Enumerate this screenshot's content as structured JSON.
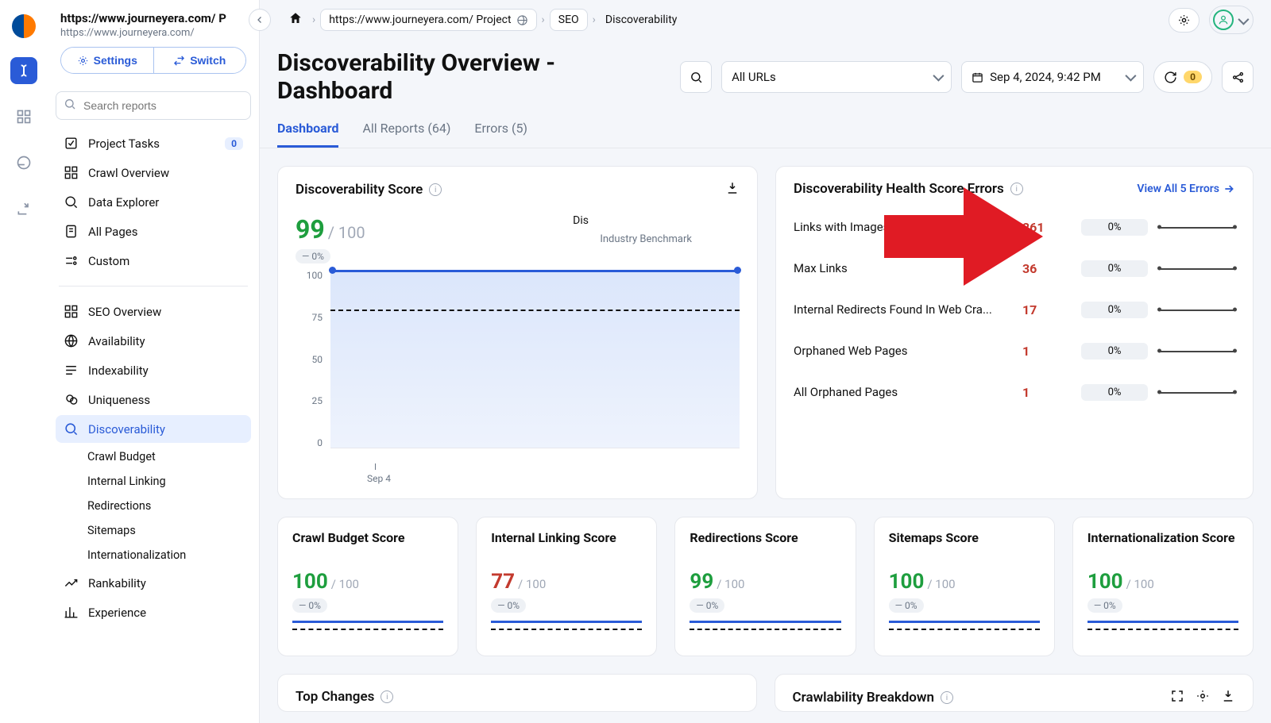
{
  "project": {
    "title": "https://www.journeyera.com/ P",
    "url": "https://www.journeyera.com/"
  },
  "sidebar_buttons": {
    "settings": "Settings",
    "switch": "Switch"
  },
  "search_placeholder": "Search reports",
  "nav": {
    "tasks": "Project Tasks",
    "tasks_badge": "0",
    "crawl_overview": "Crawl Overview",
    "data_explorer": "Data Explorer",
    "all_pages": "All Pages",
    "custom": "Custom",
    "seo_overview": "SEO Overview",
    "availability": "Availability",
    "indexability": "Indexability",
    "uniqueness": "Uniqueness",
    "discoverability": "Discoverability",
    "sub": {
      "crawl_budget": "Crawl Budget",
      "internal_linking": "Internal Linking",
      "redirections": "Redirections",
      "sitemaps": "Sitemaps",
      "intl": "Internationalization"
    },
    "rankability": "Rankability",
    "experience": "Experience"
  },
  "crumbs": {
    "project": "https://www.journeyera.com/ Project",
    "seo": "SEO",
    "leaf": "Discoverability"
  },
  "page_title": "Discoverability Overview - Dashboard",
  "filters": {
    "url": "All URLs",
    "date": "Sep 4, 2024, 9:42 PM",
    "refresh_count": "0"
  },
  "tabs": {
    "dashboard": "Dashboard",
    "all_reports": "All Reports (64)",
    "errors": "Errors (5)"
  },
  "score_card": {
    "title": "Discoverability Score",
    "value": "99",
    "denom": " / 100",
    "delta": "—  0%",
    "bench": "Industry Benchmark",
    "disco_prefix": "Dis",
    "x_label": "Sep 4"
  },
  "chart_data": {
    "type": "line",
    "x": [
      "Sep 4"
    ],
    "series": [
      {
        "name": "Score",
        "values": [
          99
        ]
      },
      {
        "name": "Benchmark",
        "values": [
          78
        ]
      }
    ],
    "ylabel": "",
    "ylim": [
      0,
      100
    ],
    "yticks": [
      100,
      75,
      50,
      25,
      0
    ]
  },
  "errors_card": {
    "title": "Discoverability Health Score Errors",
    "link": "View All 5 Errors"
  },
  "error_rows": [
    {
      "name": "Links with Images Missing Alt Tags",
      "count": "261",
      "pct": "0%"
    },
    {
      "name": "Max Links",
      "count": "36",
      "pct": "0%"
    },
    {
      "name": "Internal Redirects Found In Web Cra...",
      "count": "17",
      "pct": "0%"
    },
    {
      "name": "Orphaned Web Pages",
      "count": "1",
      "pct": "0%"
    },
    {
      "name": "All Orphaned Pages",
      "count": "1",
      "pct": "0%"
    }
  ],
  "mini_scores": [
    {
      "title": "Crawl Budget Score",
      "value": "100",
      "denom": " / 100",
      "delta": "—  0%",
      "color": "green"
    },
    {
      "title": "Internal Linking Score",
      "value": "77",
      "denom": " / 100",
      "delta": "—  0%",
      "color": "red"
    },
    {
      "title": "Redirections Score",
      "value": "99",
      "denom": " / 100",
      "delta": "—  0%",
      "color": "green"
    },
    {
      "title": "Sitemaps Score",
      "value": "100",
      "denom": " / 100",
      "delta": "—  0%",
      "color": "green"
    },
    {
      "title": "Internationalization Score",
      "value": "100",
      "denom": " / 100",
      "delta": "—  0%",
      "color": "green"
    }
  ],
  "bottom": {
    "top_changes": "Top Changes",
    "crawlability": "Crawlability Breakdown"
  }
}
